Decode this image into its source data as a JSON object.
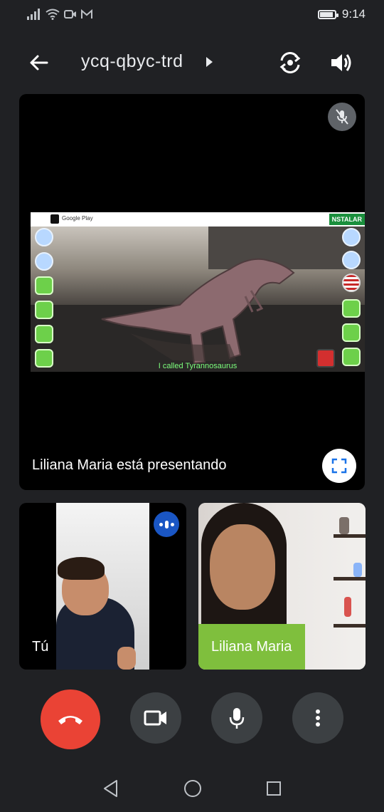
{
  "status_bar": {
    "time": "9:14",
    "battery_level": 0.9,
    "icons": [
      "signal-icon",
      "wifi-icon",
      "video-notification-icon",
      "gmail-icon",
      "battery-icon"
    ]
  },
  "meeting": {
    "code": "ycq-qbyc-trd"
  },
  "presentation": {
    "label": "Liliana Maria está presentando",
    "shared_screen": {
      "ad_store": "Google Play",
      "ad_install": "NSTALAR",
      "caption": "I called Tyrannosaurus"
    }
  },
  "participants": [
    {
      "name": "Tú",
      "speaking": true
    },
    {
      "name": "Liliana Maria",
      "speaking": false
    }
  ],
  "colors": {
    "background": "#202124",
    "end_call": "#ea4335",
    "control_bg": "#3c4043",
    "speaking_badge": "#1a56c4"
  }
}
